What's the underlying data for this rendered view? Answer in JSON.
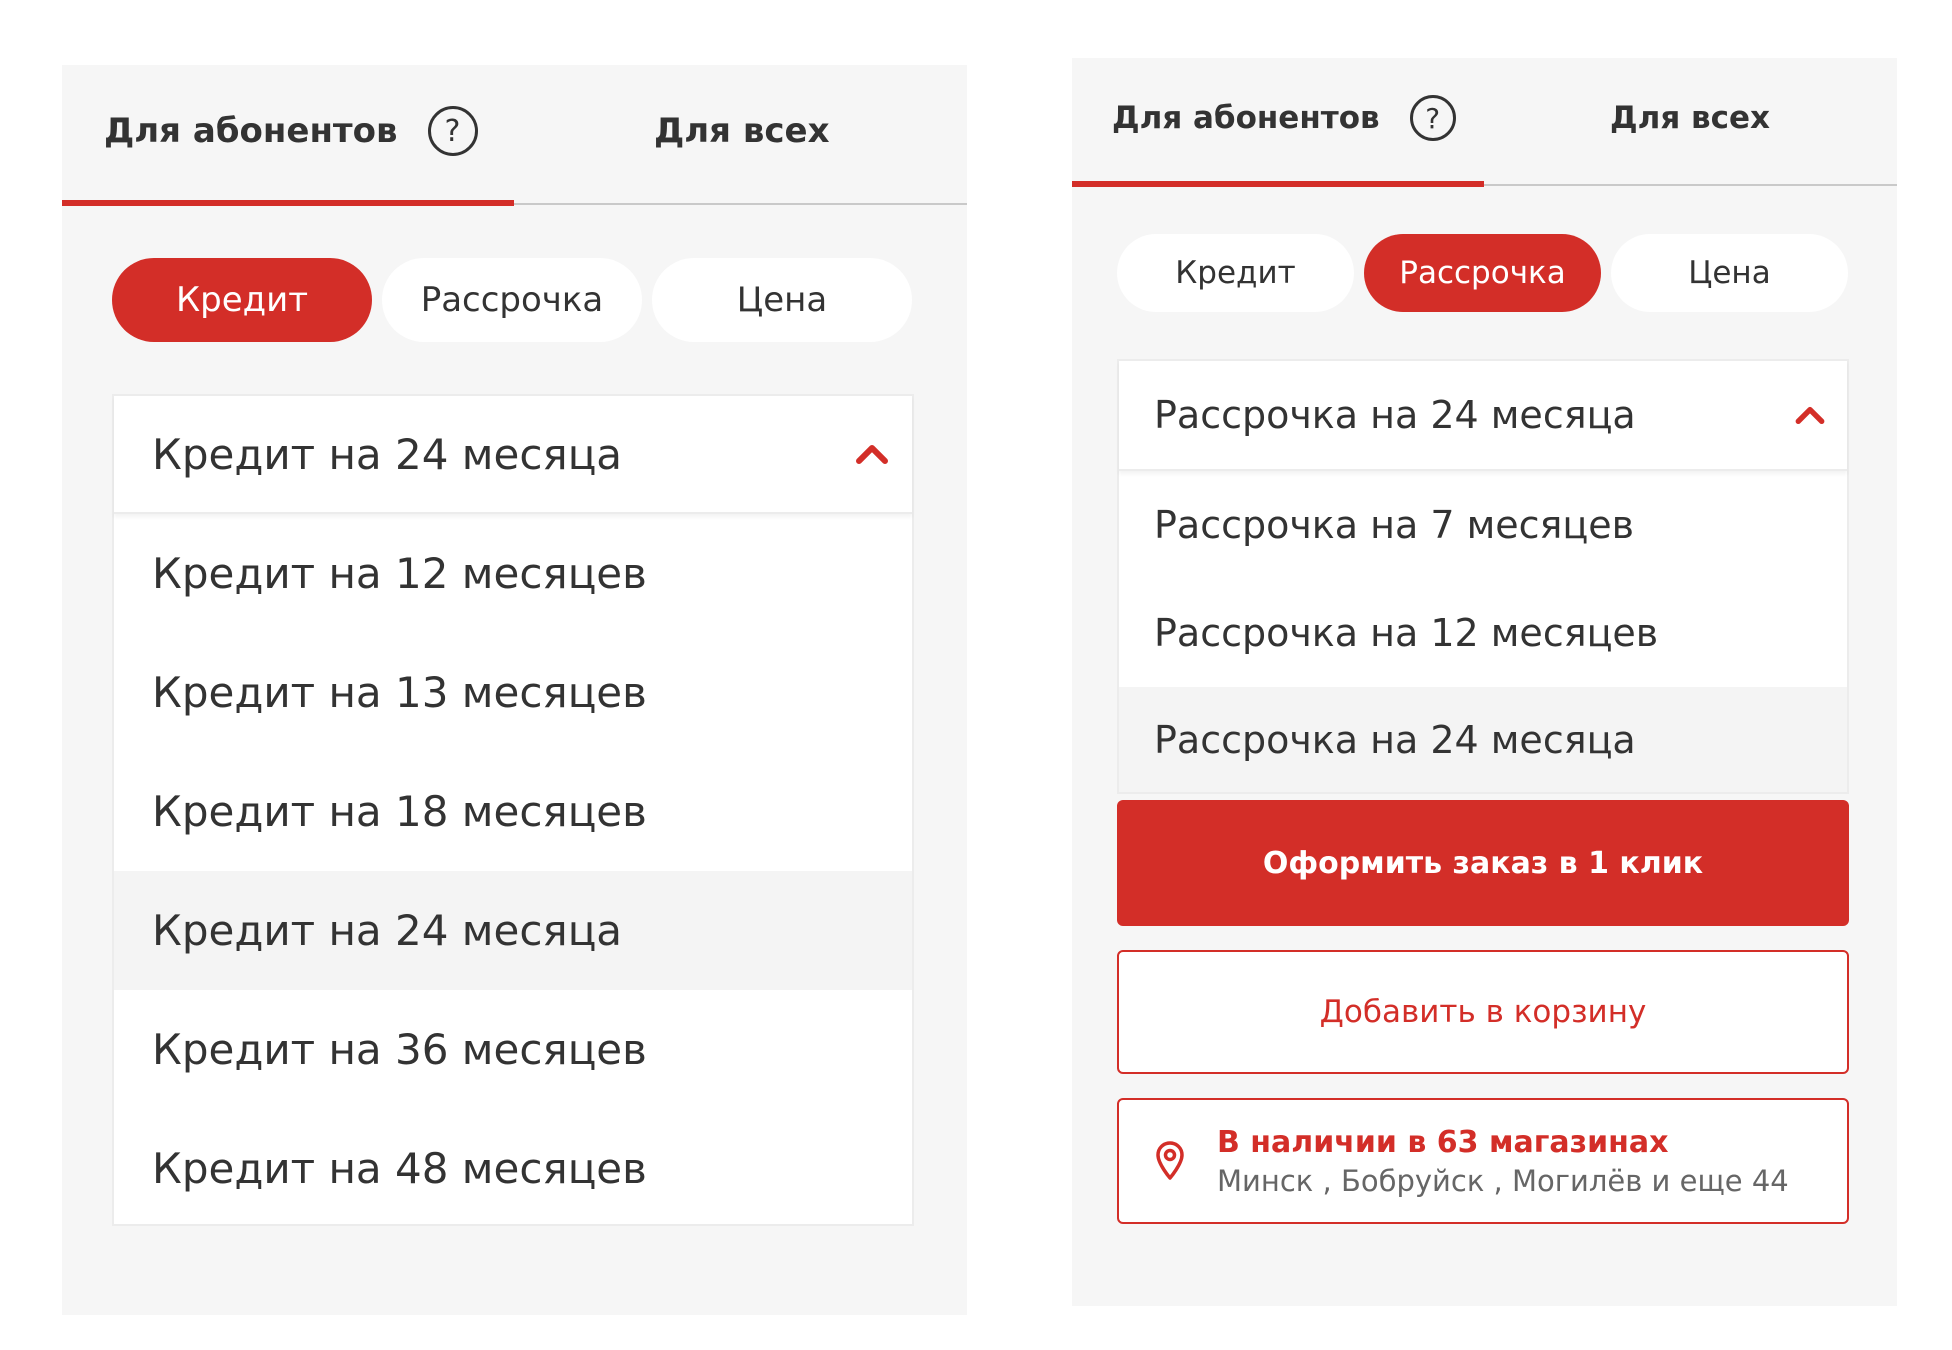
{
  "left_panel": {
    "tabs": [
      {
        "label": "Для абонентов",
        "help": "?"
      },
      {
        "label": "Для всех"
      }
    ],
    "pills": [
      "Кредит",
      "Рассрочка",
      "Цена"
    ],
    "dropdown": {
      "selected": "Кредит на 24 месяца",
      "options": [
        "Кредит на 12 месяцев",
        "Кредит на 13 месяцев",
        "Кредит на 18 месяцев",
        "Кредит на 24 месяца",
        "Кредит на 36 месяцев",
        "Кредит на 48 месяцев"
      ]
    }
  },
  "right_panel": {
    "tabs": [
      {
        "label": "Для абонентов",
        "help": "?"
      },
      {
        "label": "Для всех"
      }
    ],
    "pills": [
      "Кредит",
      "Рассрочка",
      "Цена"
    ],
    "dropdown": {
      "selected": "Рассрочка на 24 месяца",
      "options": [
        "Рассрочка на 7 месяцев",
        "Рассрочка на 12 месяцев",
        "Рассрочка на 24 месяца"
      ]
    },
    "order_button": "Оформить заказ в 1 клик",
    "cart_button": "Добавить в корзину",
    "availability": {
      "title": "В наличии в 63 магазинах",
      "cities": "Минск , Бобруйск , Могилёв и еще 44"
    }
  },
  "colors": {
    "accent": "#d32e28",
    "panel_bg": "#f6f6f6",
    "text": "#333333",
    "muted": "#666666"
  },
  "icons": {
    "help": "question-circle-icon",
    "chevron": "chevron-up-icon",
    "location": "map-pin-icon"
  }
}
